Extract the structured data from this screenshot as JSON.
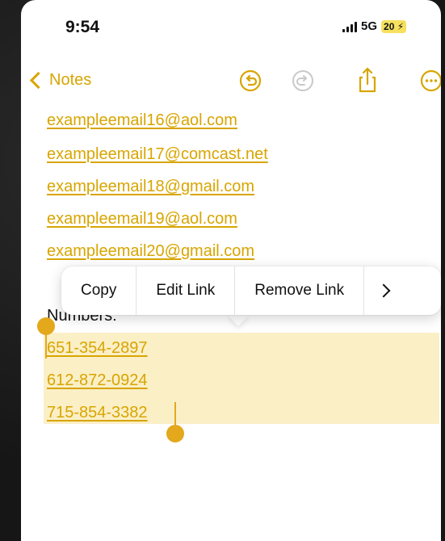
{
  "status": {
    "time": "9:54",
    "network": "5G",
    "battery": "20"
  },
  "nav": {
    "back_label": "Notes"
  },
  "note": {
    "emails": [
      "exampleemail16@aol.com",
      "exampleemail17@comcast.net",
      "exampleemail18@gmail.com",
      "exampleemail19@aol.com",
      "exampleemail20@gmail.com"
    ],
    "numbers_heading": "Numbers:",
    "numbers": [
      "651-354-2897",
      "612-872-0924",
      "715-854-3382"
    ]
  },
  "context_menu": {
    "items": [
      "Copy",
      "Edit Link",
      "Remove Link"
    ]
  },
  "colors": {
    "accent": "#d8a500",
    "selection": "#fbefc6",
    "handle": "#e3a81c"
  }
}
